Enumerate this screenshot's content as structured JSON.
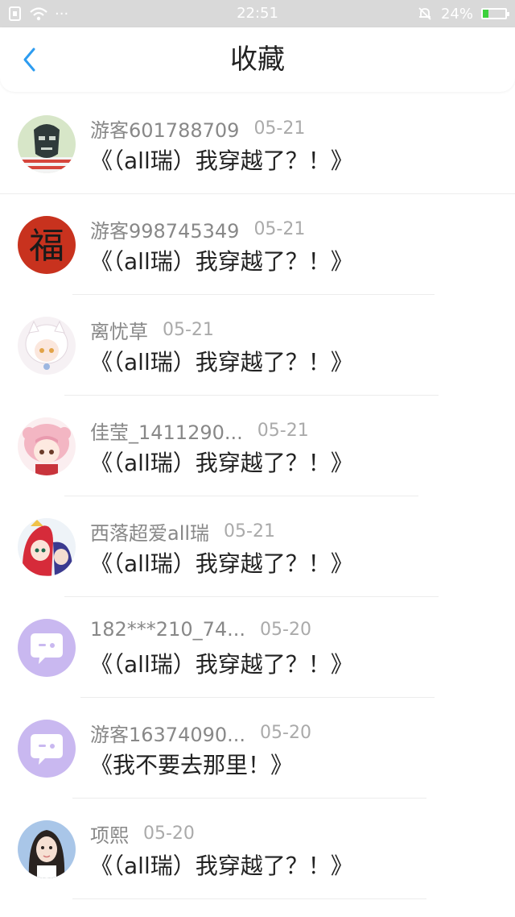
{
  "status_bar": {
    "time": "22:51",
    "battery_text": "24%",
    "battery_level": 0.24,
    "more_dots": "···"
  },
  "header": {
    "title": "收藏"
  },
  "items": [
    {
      "author": "游客601788709",
      "date": "05-21",
      "title": "《（all瑞）我穿越了？！》",
      "avatar": "masked-man-avatar"
    },
    {
      "author": "游客998745349",
      "date": "05-21",
      "title": "《（all瑞）我穿越了？！》",
      "avatar": "fu-character-avatar",
      "avatar_char": "福"
    },
    {
      "author": "离忧草",
      "date": "05-21",
      "title": "《（all瑞）我穿越了？！》",
      "avatar": "anime-white-hair-avatar"
    },
    {
      "author": "佳莹_1411290...",
      "date": "05-21",
      "title": "《（all瑞）我穿越了？！》",
      "avatar": "anime-pink-hair-avatar"
    },
    {
      "author": "西落超爱all瑞",
      "date": "05-21",
      "title": "《（all瑞）我穿越了？！》",
      "avatar": "anime-red-hair-avatar"
    },
    {
      "author": "182***210_74...",
      "date": "05-20",
      "title": "《（all瑞）我穿越了？！》",
      "avatar": "default-chat-avatar"
    },
    {
      "author": "游客16374090...",
      "date": "05-20",
      "title": "《我不要去那里！》",
      "avatar": "default-chat-avatar"
    },
    {
      "author": "项熙",
      "date": "05-20",
      "title": "《（all瑞）我穿越了？！》",
      "avatar": "girl-photo-avatar"
    }
  ],
  "colors": {
    "accent": "#2d9cf0",
    "status_bar_bg": "#d9d9d9",
    "default_avatar_bg": "#c9b8f0",
    "battery_green": "#3cd13c"
  }
}
